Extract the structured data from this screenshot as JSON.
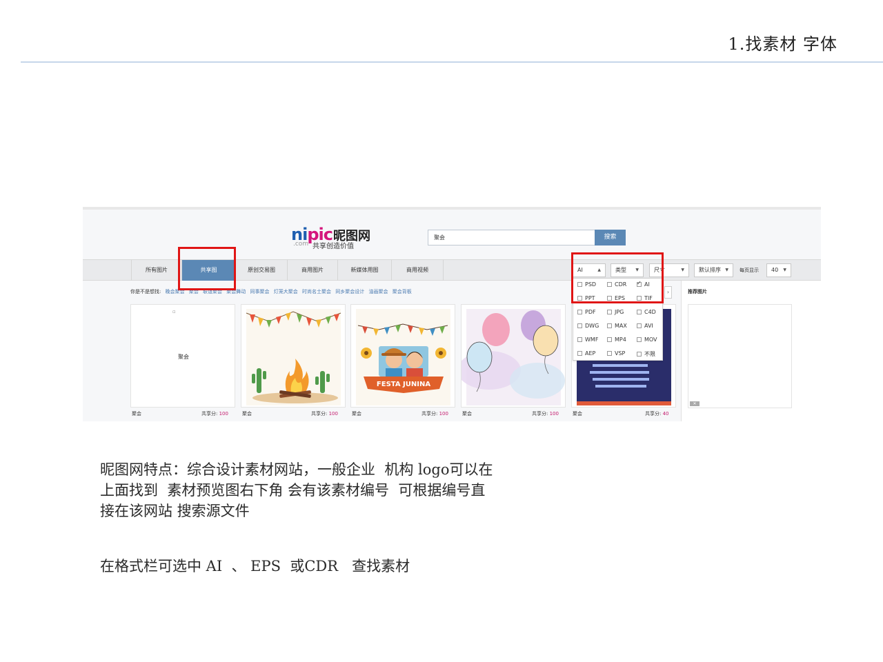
{
  "slide": {
    "title": "1.找素材 字体",
    "note_lines": [
      "昵图网特点：综合设计素材网站，一般企业  机构 logo可以在",
      "上面找到  素材预览图右下角 会有该素材编号  可根据编号直",
      "接在该网站 搜索源文件"
    ],
    "note2": "在格式栏可选中 AI  、 EPS  或CDR   查找素材",
    "highlight_color": "#e01515"
  },
  "site": {
    "logo_latin_ni": "ni",
    "logo_latin_pic": "pic",
    "logo_cn": "昵图网",
    "logo_com": ".com",
    "logo_slogan": "共享创造价值",
    "search_value": "聚会",
    "search_button": "搜索",
    "accent": "#5b88b5",
    "tabs": [
      "所有图片",
      "共享图",
      "原创交易图",
      "商用图片",
      "新媒体用图",
      "商用视频"
    ],
    "active_tab": 1,
    "filters": {
      "format": "AI",
      "type": "类型",
      "size": "尺寸",
      "sort": "默认排序",
      "per_page_label": "每页显示",
      "per_page": "40"
    },
    "format_options": [
      [
        {
          "label": "PSD",
          "checked": false
        },
        {
          "label": "CDR",
          "checked": false
        },
        {
          "label": "AI",
          "checked": true
        }
      ],
      [
        {
          "label": "PPT",
          "checked": false
        },
        {
          "label": "EPS",
          "checked": false
        },
        {
          "label": "TIF",
          "checked": false
        }
      ],
      [
        {
          "label": "PDF",
          "checked": false
        },
        {
          "label": "JPG",
          "checked": false
        },
        {
          "label": "C4D",
          "checked": false
        }
      ],
      [
        {
          "label": "DWG",
          "checked": false
        },
        {
          "label": "MAX",
          "checked": false
        },
        {
          "label": "AVI",
          "checked": false
        }
      ],
      [
        {
          "label": "WMF",
          "checked": false
        },
        {
          "label": "MP4",
          "checked": false
        },
        {
          "label": "MOV",
          "checked": false
        }
      ],
      [
        {
          "label": "AEP",
          "checked": false
        },
        {
          "label": "VSP",
          "checked": false
        },
        {
          "label": "不限",
          "checked": false
        }
      ]
    ],
    "suggest_label": "你是不是想找:",
    "suggest_keywords": [
      "晚会聚会",
      "聚会",
      "联谊聚会",
      "聚会舞动",
      "同事聚会",
      "灯笼大聚会",
      "时尚名士聚会",
      "同乡聚会设计",
      "油画聚会",
      "聚会背板"
    ],
    "recommend_title": "推荐图片",
    "recommend_close": "✕",
    "results": [
      {
        "title": "聚会",
        "score_label": "共享分:",
        "score": "100",
        "placeholder": "聚会"
      },
      {
        "title": "聚会",
        "score_label": "共享分:",
        "score": "100",
        "banner": ""
      },
      {
        "title": "聚会",
        "score_label": "共享分:",
        "score": "100",
        "banner": "FESTA JUNINA"
      },
      {
        "title": "聚会",
        "score_label": "共享分:",
        "score": "100"
      },
      {
        "title": "聚会",
        "score_label": "共享分:",
        "score": "40"
      }
    ]
  }
}
